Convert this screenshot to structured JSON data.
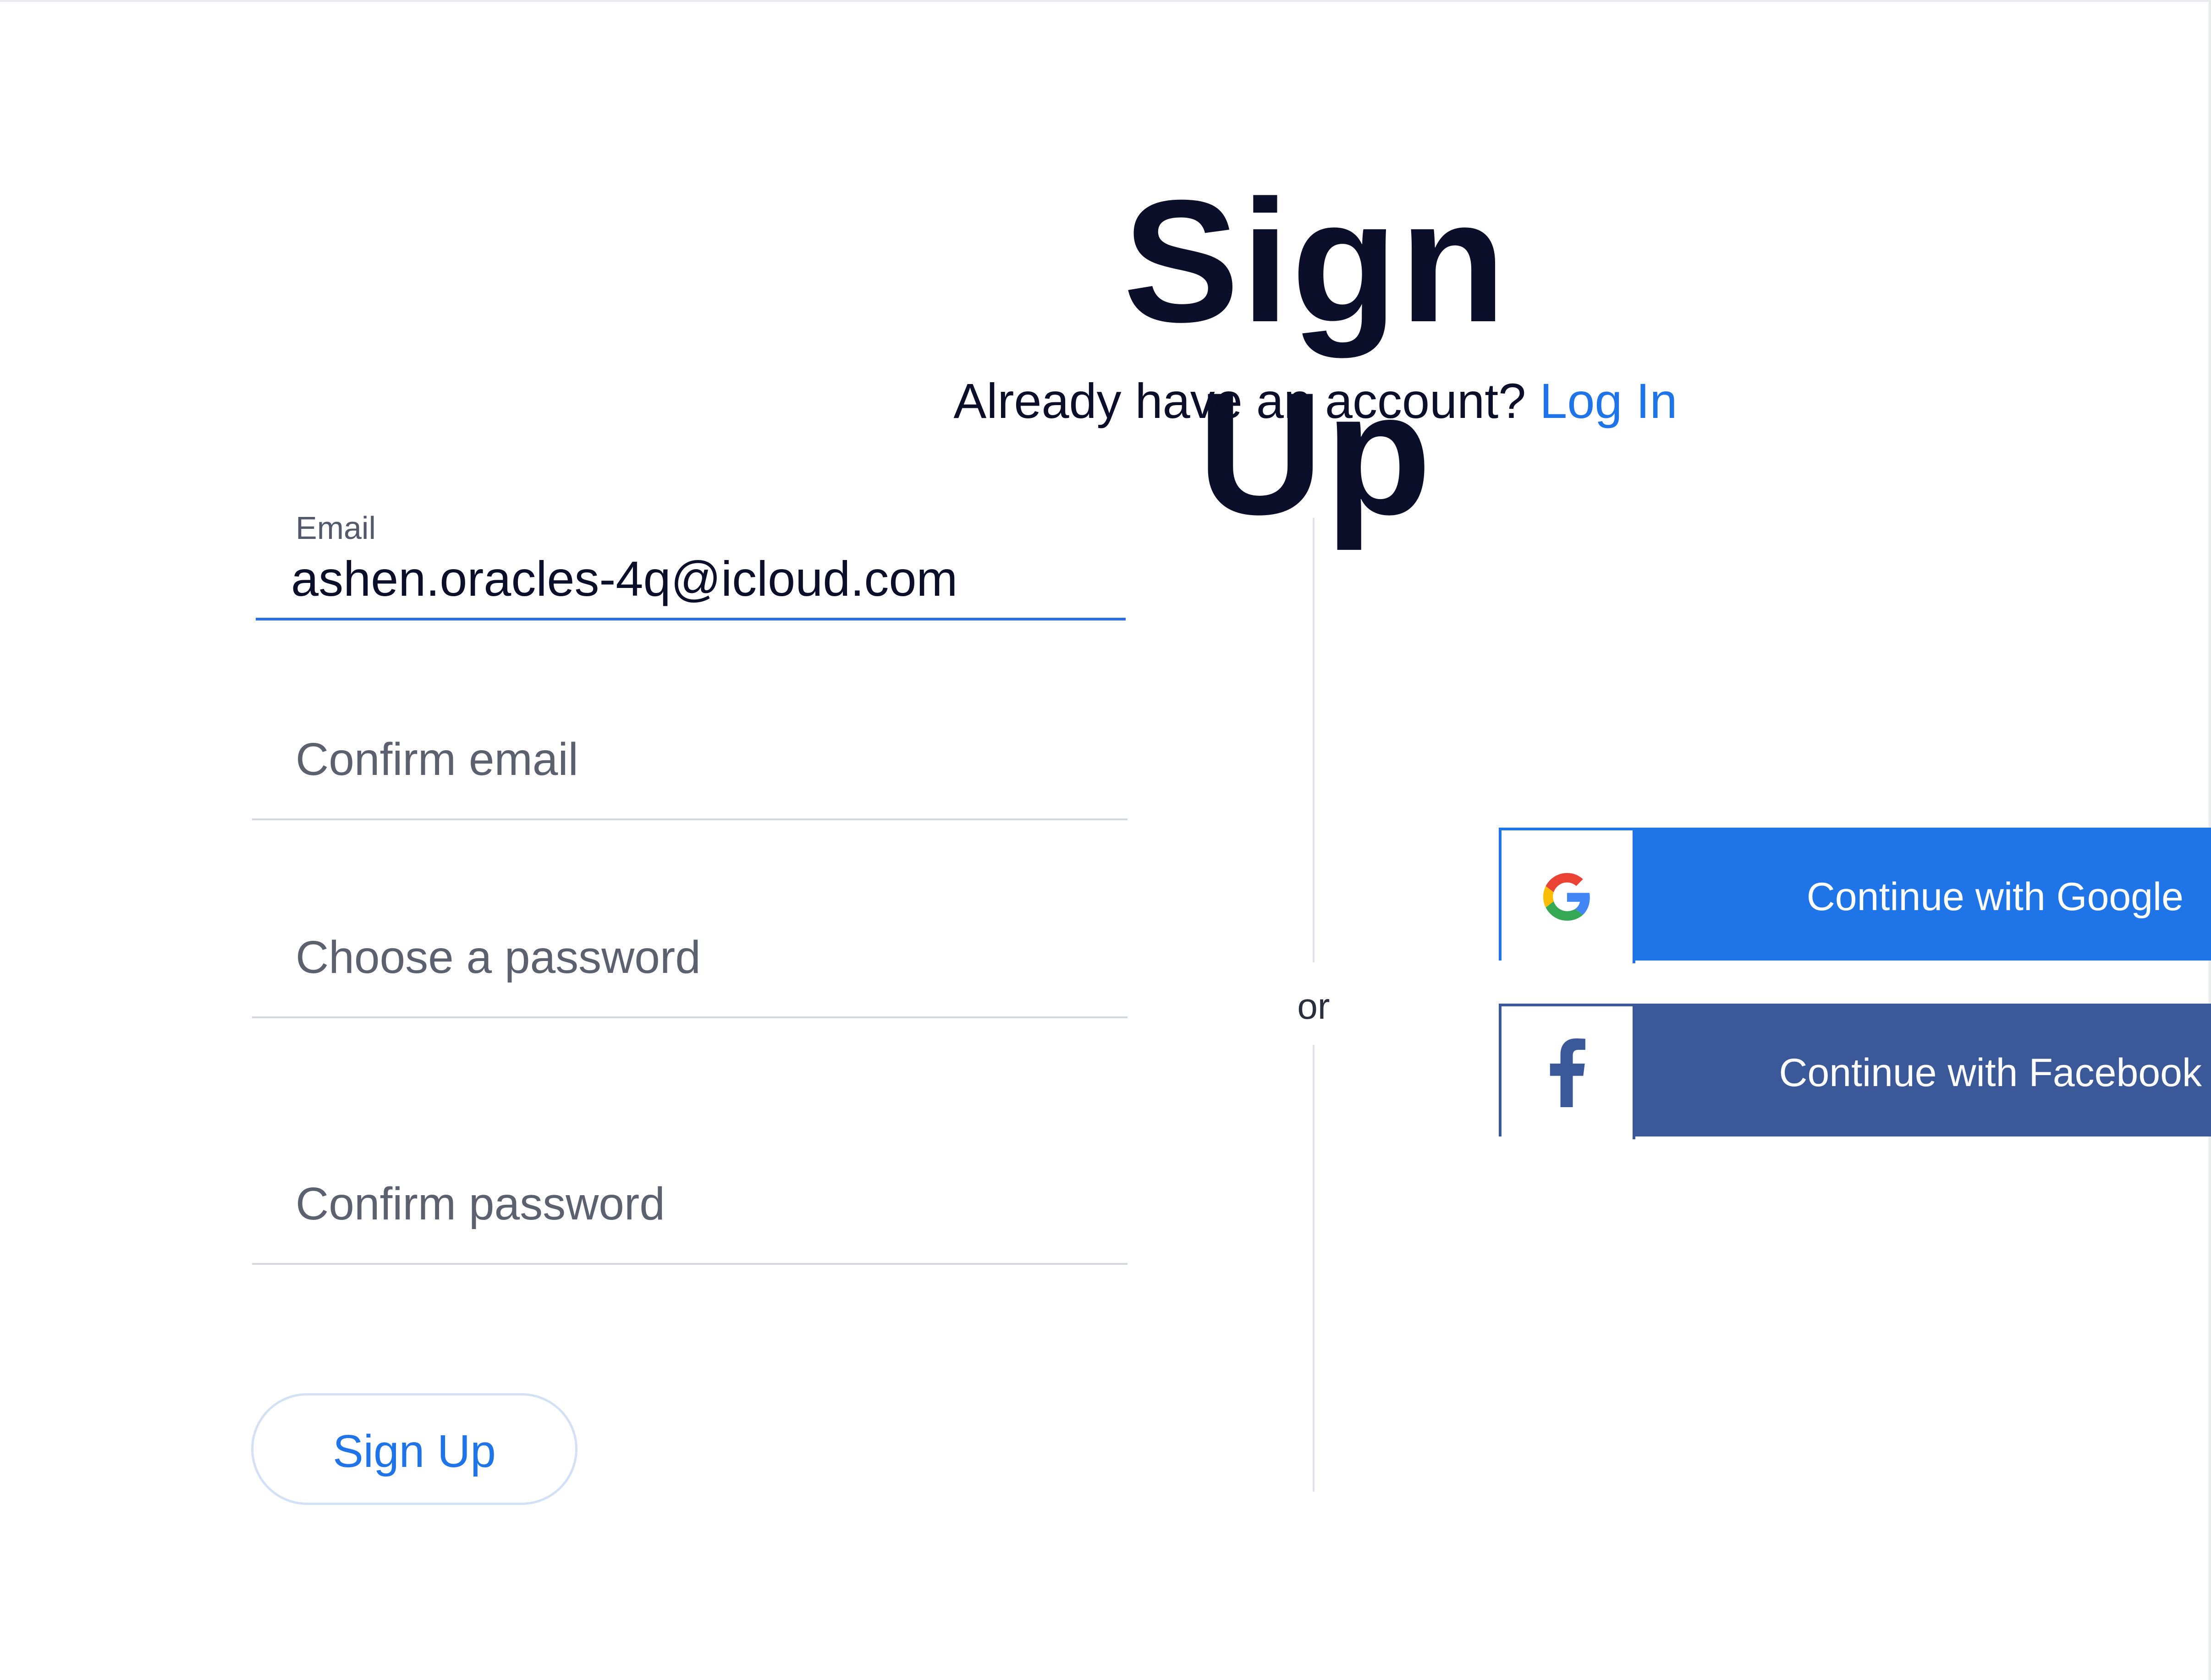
{
  "header": {
    "title": "Sign Up",
    "subtitle_prefix": "Already have an account?",
    "login_link": "Log In"
  },
  "form": {
    "email": {
      "label": "Email",
      "value": "ashen.oracles-4q@icloud.com"
    },
    "confirm_email": {
      "placeholder": "Confirm email"
    },
    "password": {
      "placeholder": "Choose a password"
    },
    "confirm_password": {
      "placeholder": "Confirm password"
    },
    "submit_label": "Sign Up"
  },
  "divider": {
    "label": "or"
  },
  "social": {
    "google": {
      "label": "Continue with Google",
      "icon": "google-icon",
      "color": "#1f75e8"
    },
    "facebook": {
      "label": "Continue with Facebook",
      "icon": "facebook-icon",
      "color": "#3b5998"
    }
  },
  "colors": {
    "accent": "#1f75e8",
    "text": "#0b0f2a",
    "placeholder": "#5c6170",
    "divider": "#dfe2e8"
  }
}
